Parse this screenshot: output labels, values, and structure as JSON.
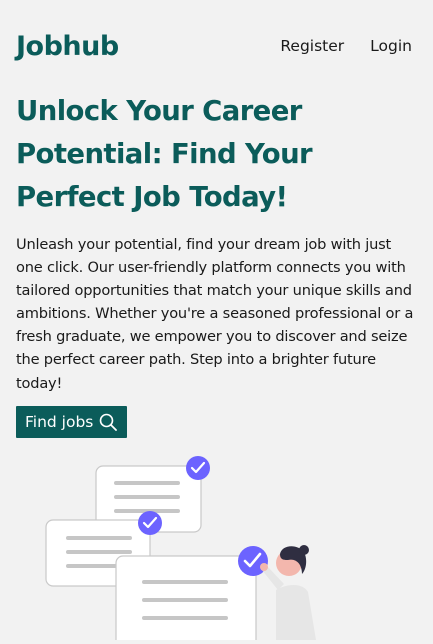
{
  "header": {
    "logo": "Jobhub",
    "nav": {
      "register": "Register",
      "login": "Login"
    }
  },
  "hero": {
    "title": "Unlock Your Career Potential: Find Your Perfect Job Today!",
    "description": "Unleash your potential, find your dream job with just one click. Our user-friendly platform connects you with tailored opportunities that match your unique skills and ambitions. Whether you're a seasoned professional or a fresh graduate, we empower you to discover and seize the perfect career path. Step into a brighter future today!",
    "cta_label": "Find jobs",
    "cta_icon": "search-icon"
  },
  "colors": {
    "brand": "#0b5c5a",
    "accent": "#6c63ff",
    "background": "#f2f2f2"
  }
}
